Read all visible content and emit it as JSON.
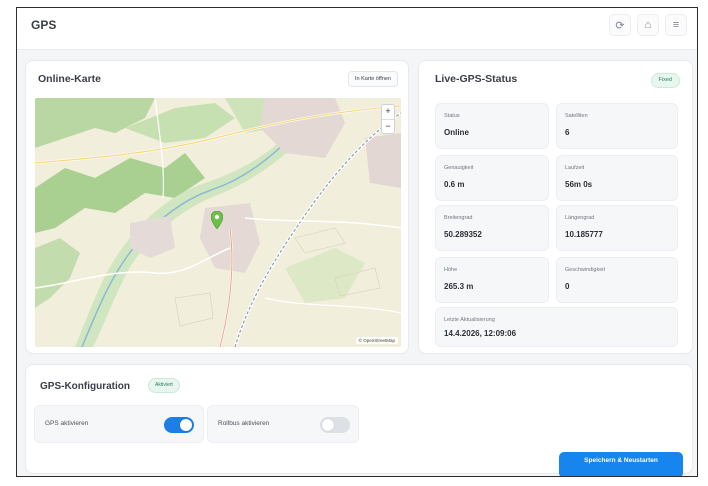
{
  "header": {
    "title": "GPS",
    "actions": [
      {
        "icon": "refresh-icon",
        "glyph": "⟳"
      },
      {
        "icon": "home-icon",
        "glyph": "⌂"
      },
      {
        "icon": "menu-icon",
        "glyph": "≡"
      }
    ]
  },
  "map": {
    "title": "Online-Karte",
    "open_button": "In Karte öffnen",
    "zoom_in": "+",
    "zoom_out": "−",
    "attribution": "© OpenStreetMap"
  },
  "status": {
    "title": "Live-GPS-Status",
    "badge": "Fixed",
    "fields": {
      "status": {
        "label": "Status",
        "value": "Online"
      },
      "satellites": {
        "label": "Satelliten",
        "value": "6"
      },
      "accuracy": {
        "label": "Genauigkeit",
        "value": "0.6 m"
      },
      "duration": {
        "label": "Laufzeit",
        "value": "56m 0s"
      },
      "latitude": {
        "label": "Breitengrad",
        "value": "50.289352"
      },
      "longitude": {
        "label": "Längengrad",
        "value": "10.185777"
      },
      "altitude": {
        "label": "Höhe",
        "value": "265.3 m"
      },
      "speed": {
        "label": "Geschwindigkeit",
        "value": "0"
      },
      "last_update": {
        "label": "Letzte Aktualisierung",
        "value": "14.4.2026, 12:09:06"
      }
    }
  },
  "config": {
    "title": "GPS-Konfiguration",
    "badge": "Aktiviert",
    "gps_toggle": {
      "label": "GPS aktivieren",
      "on": true
    },
    "rollbus_toggle": {
      "label": "Rollbus aktivieren",
      "on": false
    },
    "save_button": "Speichern & Neustarten"
  },
  "colors": {
    "accent": "#1785ee",
    "success": "#2e7d5a"
  }
}
